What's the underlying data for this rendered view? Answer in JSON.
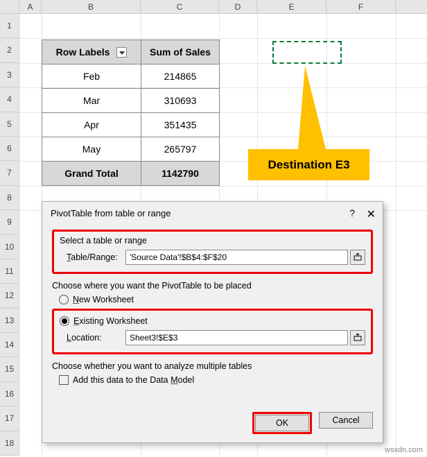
{
  "columns": [
    "A",
    "B",
    "C",
    "D",
    "E",
    "F"
  ],
  "rows": [
    "1",
    "2",
    "3",
    "4",
    "5",
    "6",
    "7",
    "8",
    "9",
    "10",
    "11",
    "12",
    "13",
    "14",
    "15",
    "16",
    "17",
    "18"
  ],
  "pivot": {
    "headers": {
      "rowlabels": "Row Labels",
      "sum": "Sum of Sales"
    },
    "data": [
      {
        "label": "Feb",
        "value": "214865"
      },
      {
        "label": "Mar",
        "value": "310693"
      },
      {
        "label": "Apr",
        "value": "351435"
      },
      {
        "label": "May",
        "value": "265797"
      }
    ],
    "total": {
      "label": "Grand Total",
      "value": "1142790"
    }
  },
  "callout": {
    "text": "Destination E3"
  },
  "dialog": {
    "title": "PivotTable from table or range",
    "help": "?",
    "close": "✕",
    "section1": {
      "label": "Select a table or range",
      "field_label": "Table/Range:",
      "field_value": "'Source Data'!$B$4:$F$20"
    },
    "section2": {
      "label": "Choose where you want the PivotTable to be placed",
      "option_new": "New Worksheet",
      "option_existing": "Existing Worksheet",
      "loc_label": "Location:",
      "loc_value": "Sheet3!$E$3"
    },
    "section3": {
      "label": "Choose whether you want to analyze multiple tables",
      "checkbox": "Add this data to the Data Model"
    },
    "buttons": {
      "ok": "OK",
      "cancel": "Cancel"
    }
  },
  "watermark": "wsxdn.com"
}
